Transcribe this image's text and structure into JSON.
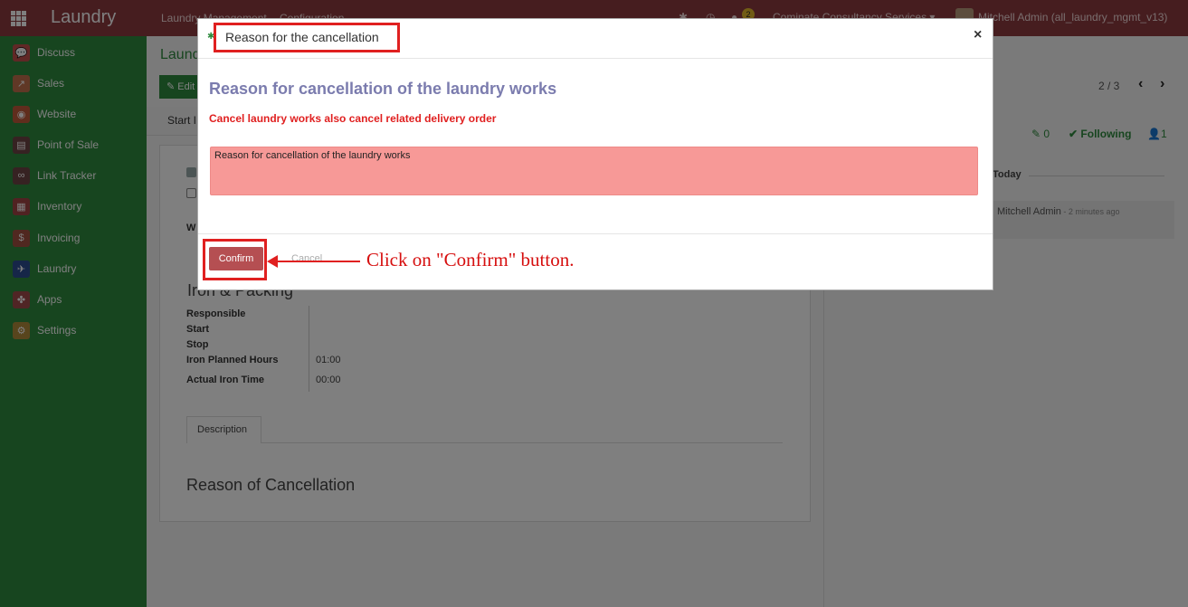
{
  "topbar": {
    "app_name": "Laundry",
    "menu": [
      "Laundry Management",
      "Configuration"
    ],
    "chat_count": "2",
    "company": "Cominate Consultancy Services ▾",
    "user": "Mitchell Admin (all_laundry_mgmt_v13)"
  },
  "sidebar": {
    "items": [
      {
        "label": "Discuss",
        "icon": "chat-bubble-icon",
        "color": "#c0504d"
      },
      {
        "label": "Sales",
        "icon": "chart-icon",
        "color": "#c0704d"
      },
      {
        "label": "Website",
        "icon": "globe-icon",
        "color": "#c05a3a"
      },
      {
        "label": "Point of Sale",
        "icon": "store-icon",
        "color": "#6c4444"
      },
      {
        "label": "Link Tracker",
        "icon": "link-icon",
        "color": "#6c4444"
      },
      {
        "label": "Inventory",
        "icon": "box-icon",
        "color": "#a04444"
      },
      {
        "label": "Invoicing",
        "icon": "invoice-icon",
        "color": "#a05040"
      },
      {
        "label": "Laundry",
        "icon": "laundry-icon",
        "color": "#2c4c90"
      },
      {
        "label": "Apps",
        "icon": "puzzle-icon",
        "color": "#a04a4a"
      },
      {
        "label": "Settings",
        "icon": "gear-icon",
        "color": "#b08a3a"
      }
    ]
  },
  "background": {
    "breadcrumb": "Laund",
    "edit_label": "✎ Edit",
    "start_label": "Start I",
    "pager": "2 / 3",
    "letter_w": "W",
    "section_title": "Iron & Packing",
    "fields": [
      {
        "label": "Responsible",
        "value": ""
      },
      {
        "label": "Start",
        "value": ""
      },
      {
        "label": "Stop",
        "value": ""
      },
      {
        "label": "Iron Planned Hours",
        "value": "01:00"
      },
      {
        "label": "Actual Iron Time",
        "value": "00:00"
      }
    ],
    "tab_label": "Description",
    "reason_title": "Reason of Cancellation",
    "chatter": {
      "attachments": "0",
      "following": "Following",
      "followers": "1",
      "today": "Today",
      "author": "Mitchell Admin",
      "time": " - 2 minutes ago"
    }
  },
  "modal": {
    "title": "Reason for the cancellation",
    "close": "×",
    "heading": "Reason for cancellation of the laundry works",
    "warning": "Cancel laundry works also cancel related delivery order",
    "reason_value": "Reason for cancellation of the laundry works",
    "confirm_label": "Confirm",
    "cancel_label": "Cancel"
  },
  "annotation": "Click on \"Confirm\" button.",
  "colors": {
    "navbar": "#8c3a3f",
    "sidebar": "#2f8b3f",
    "highlight": "#e02020"
  }
}
